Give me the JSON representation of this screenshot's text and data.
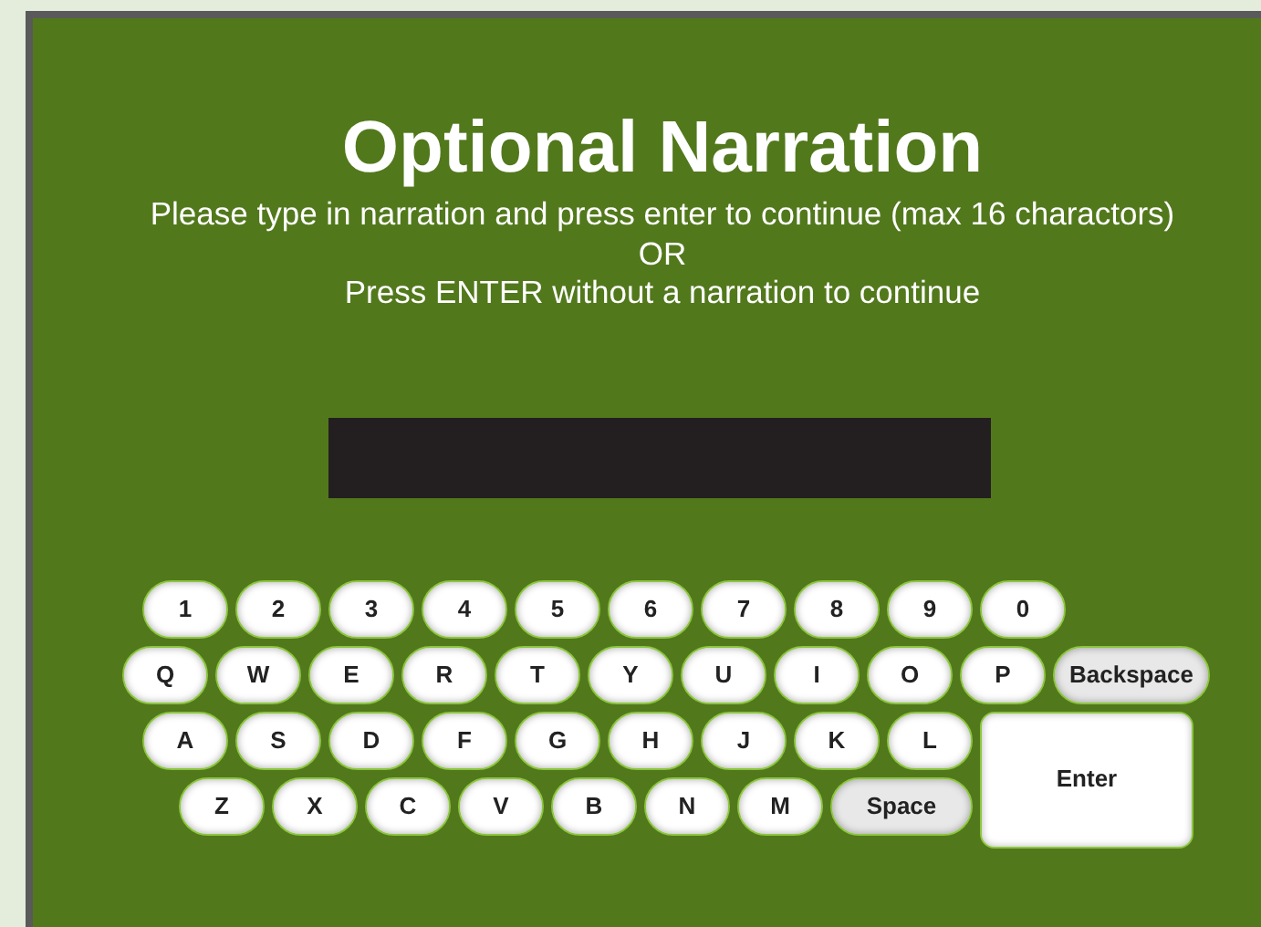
{
  "title": "Optional Narration",
  "instructions": [
    "Please type in narration and press enter to continue (max 16 charactors)",
    "OR",
    "Press ENTER without a narration to continue"
  ],
  "keyboard": {
    "rows": [
      [
        {
          "label": "1",
          "kind": "char"
        },
        {
          "label": "2",
          "kind": "char"
        },
        {
          "label": "3",
          "kind": "char"
        },
        {
          "label": "4",
          "kind": "char"
        },
        {
          "label": "5",
          "kind": "char"
        },
        {
          "label": "6",
          "kind": "char"
        },
        {
          "label": "7",
          "kind": "char"
        },
        {
          "label": "8",
          "kind": "char"
        },
        {
          "label": "9",
          "kind": "char"
        },
        {
          "label": "0",
          "kind": "char"
        }
      ],
      [
        {
          "label": "Q",
          "kind": "char"
        },
        {
          "label": "W",
          "kind": "char"
        },
        {
          "label": "E",
          "kind": "char"
        },
        {
          "label": "R",
          "kind": "char"
        },
        {
          "label": "T",
          "kind": "char"
        },
        {
          "label": "Y",
          "kind": "char"
        },
        {
          "label": "U",
          "kind": "char"
        },
        {
          "label": "I",
          "kind": "char"
        },
        {
          "label": "O",
          "kind": "char"
        },
        {
          "label": "P",
          "kind": "char"
        }
      ],
      [
        {
          "label": "A",
          "kind": "char"
        },
        {
          "label": "S",
          "kind": "char"
        },
        {
          "label": "D",
          "kind": "char"
        },
        {
          "label": "F",
          "kind": "char"
        },
        {
          "label": "G",
          "kind": "char"
        },
        {
          "label": "H",
          "kind": "char"
        },
        {
          "label": "J",
          "kind": "char"
        },
        {
          "label": "K",
          "kind": "char"
        },
        {
          "label": "L",
          "kind": "char"
        }
      ],
      [
        {
          "label": "Z",
          "kind": "char"
        },
        {
          "label": "X",
          "kind": "char"
        },
        {
          "label": "C",
          "kind": "char"
        },
        {
          "label": "V",
          "kind": "char"
        },
        {
          "label": "B",
          "kind": "char"
        },
        {
          "label": "N",
          "kind": "char"
        },
        {
          "label": "M",
          "kind": "char"
        }
      ]
    ],
    "backspace_key": {
      "label": "Backspace",
      "kind": "special"
    },
    "space_key": {
      "label": "Space",
      "kind": "special"
    },
    "enter_key": {
      "label": "Enter",
      "kind": "enter"
    }
  }
}
